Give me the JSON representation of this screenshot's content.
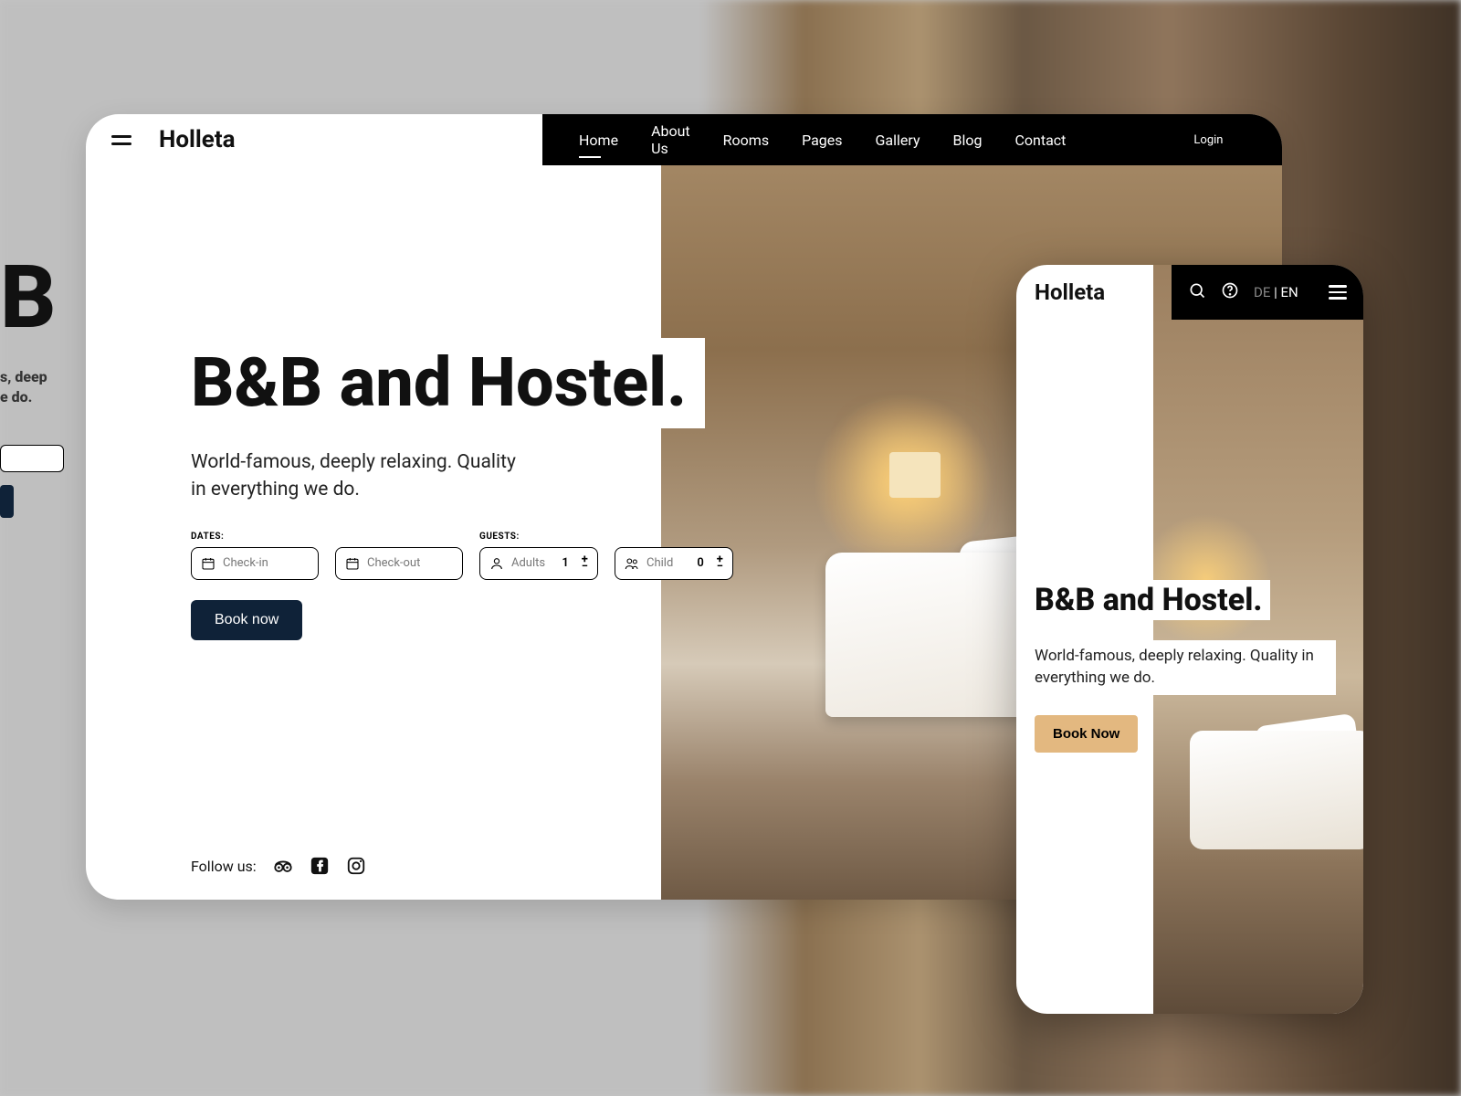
{
  "brand": "Holleta",
  "nav": {
    "items": [
      "Home",
      "About Us",
      "Rooms",
      "Pages",
      "Gallery",
      "Blog",
      "Contact"
    ],
    "login": "Login",
    "lang": {
      "de": "DE",
      "en": "EN",
      "sep": "|"
    }
  },
  "hero": {
    "title": "B&B and Hostel.",
    "subtitle": "World-famous, deeply relaxing. Quality in everything we do."
  },
  "form": {
    "dates_label": "DATES:",
    "guests_label": "GUESTS:",
    "checkin_placeholder": "Check-in",
    "checkout_placeholder": "Check-out",
    "adults_label": "Adults",
    "adults_value": "1",
    "child_label": "Child",
    "child_value": "0",
    "book": "Book now"
  },
  "follow": {
    "label": "Follow us:"
  },
  "mobile": {
    "brand": "Holleta",
    "title": "B&B and Hostel.",
    "subtitle": "World-famous, deeply relaxing. Quality in everything we do.",
    "book": "Book Now",
    "lang": {
      "de": "DE",
      "en": "EN",
      "sep": "|"
    }
  },
  "ghost": {
    "b": "B",
    "sub1": "s, deep",
    "sub2": "e do."
  }
}
